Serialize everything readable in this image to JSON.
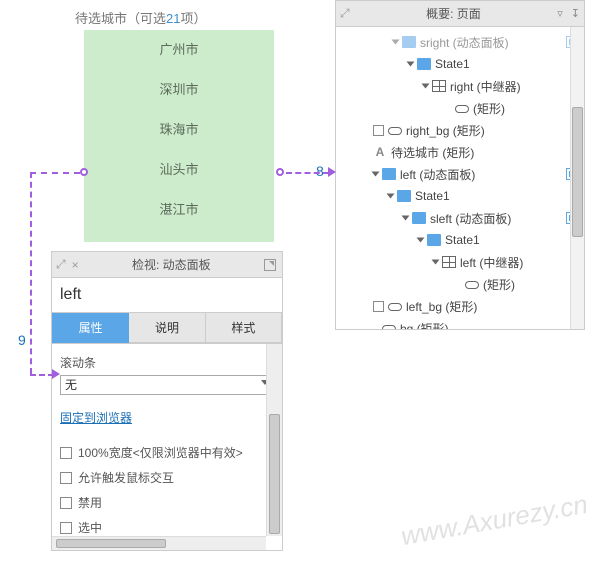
{
  "preview": {
    "header_prefix": "待选城市（可选",
    "header_count": "21",
    "header_suffix": "项）",
    "cities": [
      "广州市",
      "深圳市",
      "珠海市",
      "汕头市",
      "湛江市"
    ]
  },
  "inspect": {
    "panel_title": "检视: 动态面板",
    "widget_name": "left",
    "tabs": {
      "props": "属性",
      "notes": "说明",
      "style": "样式"
    },
    "scroll_label": "滚动条",
    "scroll_value": "无",
    "pin_link": "固定到浏览器",
    "checks": {
      "full_width": "100%宽度<仅限浏览器中有效>",
      "mouse_interact": "允许触发鼠标交互",
      "disabled": "禁用",
      "selected": "选中"
    }
  },
  "outline": {
    "panel_title": "概要: 页面",
    "rows": [
      {
        "indent": 55,
        "tri": true,
        "icon": "panel",
        "label": "sright (动态面板)",
        "eye": true,
        "faded": true
      },
      {
        "indent": 70,
        "tri": true,
        "icon": "panel",
        "label": "State1"
      },
      {
        "indent": 85,
        "tri": true,
        "icon": "repeater",
        "label": "right (中继器)"
      },
      {
        "indent": 108,
        "tri": false,
        "icon": "rect",
        "label": "(矩形)"
      },
      {
        "indent": 35,
        "chk": true,
        "icon": "rect",
        "label": "right_bg (矩形)"
      },
      {
        "indent": 35,
        "text_icon": "A",
        "label": "待选城市 (矩形)"
      },
      {
        "indent": 35,
        "tri": true,
        "icon": "panel",
        "label": "left (动态面板)",
        "eye": true
      },
      {
        "indent": 50,
        "tri": true,
        "icon": "panel",
        "label": "State1"
      },
      {
        "indent": 65,
        "tri": true,
        "icon": "panel",
        "label": "sleft (动态面板)",
        "eye": true
      },
      {
        "indent": 80,
        "tri": true,
        "icon": "panel",
        "label": "State1"
      },
      {
        "indent": 95,
        "tri": true,
        "icon": "repeater",
        "label": "left (中继器)"
      },
      {
        "indent": 118,
        "tri": false,
        "icon": "rect",
        "label": "(矩形)"
      },
      {
        "indent": 35,
        "chk": true,
        "icon": "rect",
        "label": "left_bg (矩形)"
      },
      {
        "indent": 35,
        "tri": false,
        "icon": "rect",
        "label": "bg (矩形)"
      }
    ]
  },
  "annotations": {
    "num8": "8",
    "num9": "9"
  },
  "watermark": "www.Axurezy.cn"
}
